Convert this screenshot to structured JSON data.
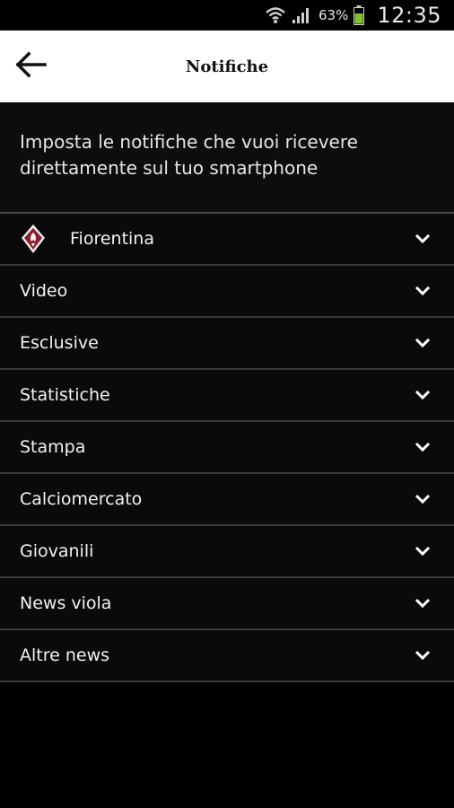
{
  "status": {
    "battery": "63%",
    "time": "12:35"
  },
  "header": {
    "title": "Notifiche"
  },
  "intro": {
    "text": "Imposta le notifiche che vuoi ricevere direttamente sul tuo smartphone"
  },
  "items": [
    {
      "label": "Fiorentina"
    },
    {
      "label": "Video"
    },
    {
      "label": "Esclusive"
    },
    {
      "label": "Statistiche"
    },
    {
      "label": "Stampa"
    },
    {
      "label": "Calciomercato"
    },
    {
      "label": "Giovanili"
    },
    {
      "label": "News viola"
    },
    {
      "label": "Altre news"
    }
  ],
  "colors": {
    "background": "#000000",
    "header_bg": "#ffffff",
    "accent": "#7b2e8a"
  }
}
